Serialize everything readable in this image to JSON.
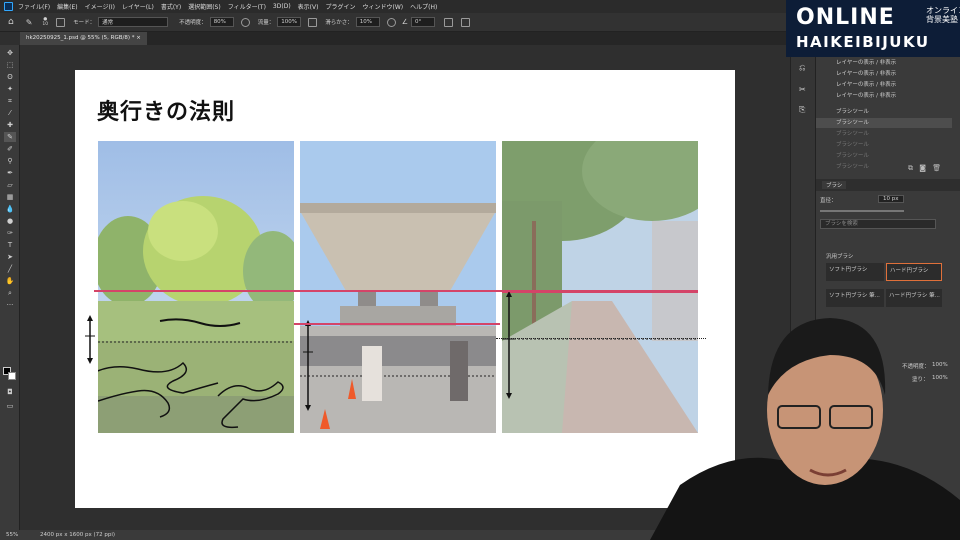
{
  "menubar": {
    "items": [
      "ファイル(F)",
      "編集(E)",
      "イメージ(I)",
      "レイヤー(L)",
      "書式(Y)",
      "選択範囲(S)",
      "フィルター(T)",
      "3D(D)",
      "表示(V)",
      "プラグイン",
      "ウィンドウ(W)",
      "ヘルプ(H)"
    ]
  },
  "options": {
    "brush_size": "10",
    "mode_label": "モード：",
    "mode_value": "通常",
    "opacity_label": "不透明度：",
    "opacity_value": "80%",
    "flow_label": "流量：",
    "flow_value": "100%",
    "smoothing_label": "滑らかさ：",
    "smoothing_value": "10%",
    "angle_value": "0°"
  },
  "document_tab": "hk20250925_1.psd @ 55% (5, RGB/8) *",
  "slide": {
    "title": "奥行きの法則"
  },
  "status": {
    "zoom": "55%",
    "size": "2400 px x 1600 px (72 ppi)"
  },
  "history": [
    {
      "label": "レイヤーの表示 / 非表示",
      "state": "normal"
    },
    {
      "label": "レイヤーの表示 / 非表示",
      "state": "normal"
    },
    {
      "label": "レイヤーの表示 / 非表示",
      "state": "normal"
    },
    {
      "label": "レイヤーの表示 / 非表示",
      "state": "normal"
    },
    {
      "label": "ブラシツール",
      "state": "normal"
    },
    {
      "label": "ブラシツール",
      "state": "selected"
    },
    {
      "label": "ブラシツール",
      "state": "dim"
    },
    {
      "label": "ブラシツール",
      "state": "dim"
    },
    {
      "label": "ブラシツール",
      "state": "dim"
    },
    {
      "label": "ブラシツール",
      "state": "dim"
    }
  ],
  "brush_panel": {
    "tab": "ブラシ",
    "size_label": "直径：",
    "size_value": "10 px",
    "search_placeholder": "ブラシを検索",
    "group": "汎用ブラシ",
    "presets": [
      "ソフト円ブラシ",
      "ハード円ブラシ",
      "ソフト円ブラシ 筆...",
      "ハード円ブラシ 筆..."
    ]
  },
  "layers_panel": {
    "opacity_label": "不透明度：",
    "opacity_value": "100%",
    "fill_label": "塗り：",
    "fill_value": "100%"
  },
  "logo": {
    "line1": "ONLINE",
    "line1_jp": "オンライン\n背景美塾",
    "line2": "HAIKEIBIJUKU"
  },
  "colors": {
    "accent_line": "#e2315a",
    "logo_bg": "#0d1d37"
  }
}
